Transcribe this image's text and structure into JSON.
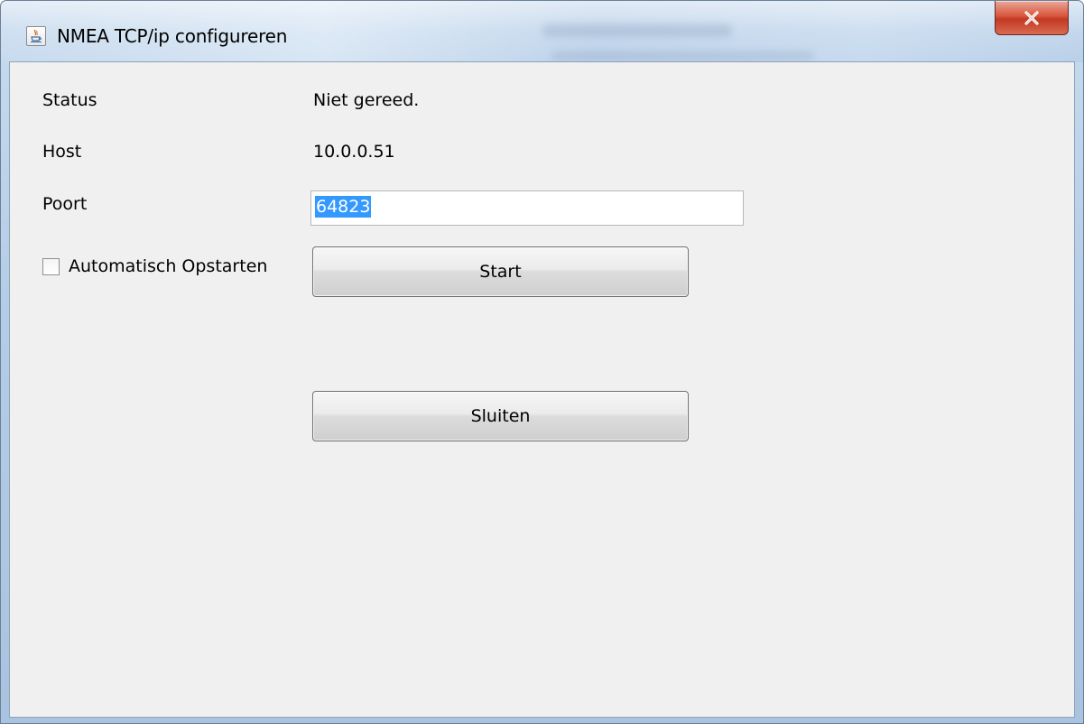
{
  "window": {
    "title": "NMEA TCP/ip configureren",
    "close_symbol": "x",
    "icon": "java-coffee-icon"
  },
  "form": {
    "status_label": "Status",
    "status_value": "Niet gereed.",
    "host_label": "Host",
    "host_value": "10.0.0.51",
    "port_label": "Poort",
    "port_value": "64823",
    "autostart_label": "Automatisch Opstarten",
    "autostart_checked": false
  },
  "buttons": {
    "start_label": "Start",
    "close_label": "Sluiten"
  },
  "colors": {
    "selection": "#3399ff",
    "close_button": "#c7432b",
    "dialog_background": "#f0f0f0"
  }
}
